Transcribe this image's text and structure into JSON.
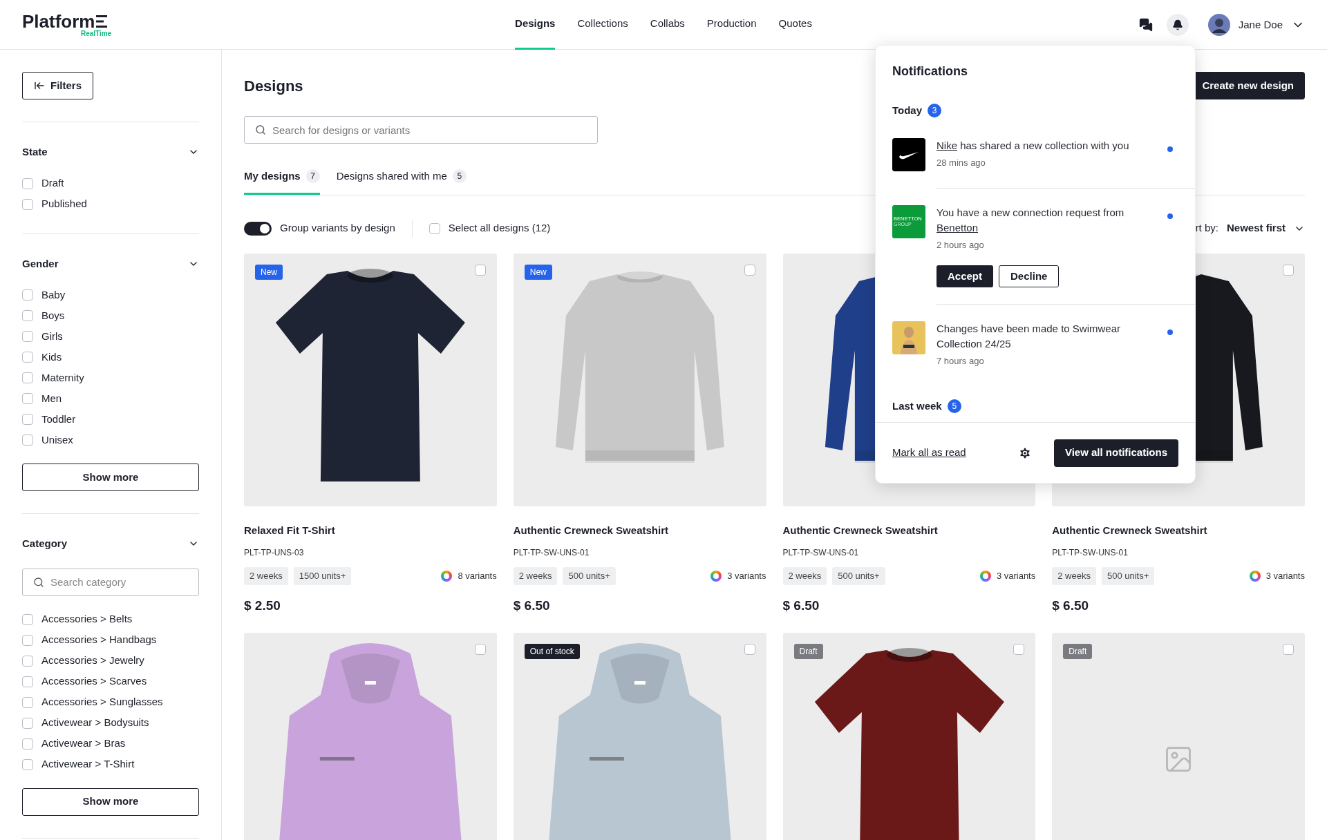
{
  "header": {
    "logo": "Platform",
    "logo_sub": "RealTime",
    "nav": [
      {
        "label": "Designs",
        "selected": true
      },
      {
        "label": "Collections",
        "selected": false
      },
      {
        "label": "Collabs",
        "selected": false
      },
      {
        "label": "Production",
        "selected": false
      },
      {
        "label": "Quotes",
        "selected": false
      }
    ],
    "user": {
      "name": "Jane Doe"
    }
  },
  "sidebar": {
    "filters_button": "Filters",
    "sections": [
      {
        "title": "State",
        "expanded": true,
        "options": [
          {
            "label": "Draft",
            "checked": false
          },
          {
            "label": "Published",
            "checked": false
          }
        ]
      },
      {
        "title": "Gender",
        "expanded": true,
        "options": [
          {
            "label": "Baby",
            "checked": false
          },
          {
            "label": "Boys",
            "checked": false
          },
          {
            "label": "Girls",
            "checked": false
          },
          {
            "label": "Kids",
            "checked": false
          },
          {
            "label": "Maternity",
            "checked": false
          },
          {
            "label": "Men",
            "checked": false
          },
          {
            "label": "Toddler",
            "checked": false
          },
          {
            "label": "Unisex",
            "checked": false
          }
        ],
        "show_more": "Show more"
      },
      {
        "title": "Category",
        "expanded": true,
        "search_placeholder": "Search category",
        "options": [
          {
            "label": "Accessories > Belts",
            "checked": false
          },
          {
            "label": "Accessories > Handbags",
            "checked": false
          },
          {
            "label": "Accessories > Jewelry",
            "checked": false
          },
          {
            "label": "Accessories > Scarves",
            "checked": false
          },
          {
            "label": "Accessories > Sunglasses",
            "checked": false
          },
          {
            "label": "Activewear > Bodysuits",
            "checked": false
          },
          {
            "label": "Activewear > Bras",
            "checked": false
          },
          {
            "label": "Activewear > T-Shirt",
            "checked": false
          }
        ],
        "show_more": "Show more"
      }
    ]
  },
  "main": {
    "title": "Designs",
    "create_button": "Create new design",
    "search_placeholder": "Search for designs or variants",
    "tabs": [
      {
        "label": "My designs",
        "count": "7",
        "selected": true
      },
      {
        "label": "Designs shared with me",
        "count": "5",
        "selected": false
      }
    ],
    "group_toggle": {
      "label": "Group variants by design",
      "on": true
    },
    "select_all": {
      "label": "Select all designs (12)",
      "checked": false
    },
    "sort": {
      "label": "rt by:",
      "value": "Newest first"
    },
    "cards": [
      {
        "badge": {
          "label": "New",
          "kind": "new"
        },
        "checked": false,
        "image": {
          "kind": "picture"
        },
        "title": "Relaxed Fit T-Shirt",
        "code": "PLT-TP-UNS-03",
        "tags": [
          "2 weeks",
          "1500 units+"
        ],
        "variants": "8 variants",
        "price": "$ 2.50"
      },
      {
        "badge": {
          "label": "New",
          "kind": "new"
        },
        "checked": false,
        "image": {
          "kind": "picture"
        },
        "title": "Authentic Crewneck Sweatshirt",
        "code": "PLT-TP-SW-UNS-01",
        "tags": [
          "2 weeks",
          "500 units+"
        ],
        "variants": "3 variants",
        "price": "$ 6.50"
      },
      {
        "image": {
          "kind": "picture"
        },
        "title": "Authentic Crewneck Sweatshirt",
        "code": "PLT-TP-SW-UNS-01",
        "tags": [
          "2 weeks",
          "500 units+"
        ],
        "variants": "3 variants",
        "price": "$ 6.50"
      },
      {
        "checked": false,
        "image": {
          "kind": "picture"
        },
        "title": "Authentic Crewneck Sweatshirt",
        "code": "PLT-TP-SW-UNS-01",
        "tags": [
          "2 weeks",
          "500 units+"
        ],
        "variants": "3 variants",
        "price": "$ 6.50"
      },
      {
        "checked": false,
        "image": {
          "kind": "picture"
        }
      },
      {
        "badge": {
          "label": "Out of stock",
          "kind": "out_of_stock"
        },
        "checked": false,
        "image": {
          "kind": "picture"
        }
      },
      {
        "badge": {
          "label": "Draft",
          "kind": "draft"
        },
        "checked": false,
        "image": {
          "kind": "picture"
        }
      },
      {
        "badge": {
          "label": "Draft",
          "kind": "draft"
        },
        "checked": false,
        "image": {
          "kind": "placeholder"
        }
      }
    ]
  },
  "notifications": {
    "title": "Notifications",
    "groups": [
      {
        "title": "Today",
        "count": "3",
        "items": [
          {
            "avatar": {
              "kind": "swoosh"
            },
            "segments": [
              {
                "text": "Nike",
                "link": true
              },
              {
                "text": "has shared a new collection with you",
                "link": false
              }
            ],
            "time": "28 mins ago",
            "unread": true
          },
          {
            "avatar": {
              "kind": "wordmark",
              "lines": [
                "BENETTON",
                "GROUP"
              ]
            },
            "segments": [
              {
                "text": "You have a new connection request from",
                "link": false
              },
              {
                "text": "Benetton",
                "link": true
              }
            ],
            "time": "2 hours ago",
            "unread": true,
            "actions": [
              {
                "label": "Accept",
                "kind": "primary"
              },
              {
                "label": "Decline",
                "kind": "secondary"
              }
            ]
          },
          {
            "avatar": {
              "kind": "picture"
            },
            "segments": [
              {
                "text": "Changes have been made to Swimwear Collection 24/25",
                "link": false
              }
            ],
            "time": "7 hours ago",
            "unread": true
          }
        ]
      },
      {
        "title": "Last week",
        "count": "5"
      }
    ],
    "mark_all": "Mark all as read",
    "view_all": "View all notifications"
  }
}
